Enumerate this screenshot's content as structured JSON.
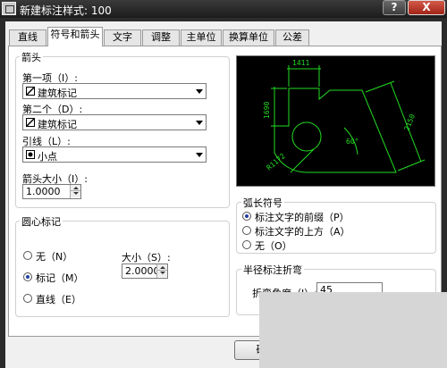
{
  "window": {
    "title": "新建标注样式: 100",
    "help_label": "?",
    "close_label": "X"
  },
  "tabs": [
    {
      "label": "直线",
      "active": false
    },
    {
      "label": "符号和箭头",
      "active": true
    },
    {
      "label": "文字",
      "active": false
    },
    {
      "label": "调整",
      "active": false
    },
    {
      "label": "主单位",
      "active": false
    },
    {
      "label": "换算单位",
      "active": false
    },
    {
      "label": "公差",
      "active": false
    }
  ],
  "arrowheads": {
    "title": "箭头",
    "first_label": "第一项（I）:",
    "first_value": "建筑标记",
    "second_label": "第二个（D）:",
    "second_value": "建筑标记",
    "leader_label": "引线（L）:",
    "leader_value": "小点",
    "size_label": "箭头大小（I）:",
    "size_value": "1.0000"
  },
  "center_marks": {
    "title": "圆心标记",
    "options": [
      {
        "label": "无（N）",
        "selected": false
      },
      {
        "label": "标记（M）",
        "selected": true
      },
      {
        "label": "直线（E）",
        "selected": false
      }
    ],
    "size_label": "大小（S）:",
    "size_value": "2.0000"
  },
  "arc_length": {
    "title": "弧长符号",
    "options": [
      {
        "label": "标注文字的前缀（P）",
        "selected": true
      },
      {
        "label": "标注文字的上方（A）",
        "selected": false
      },
      {
        "label": "无（O）",
        "selected": false
      }
    ]
  },
  "radius_jog": {
    "title": "半径标注折弯",
    "angle_label": "折弯角度（J）:",
    "angle_value": "45"
  },
  "preview": {
    "dim_top": "1411",
    "dim_left": "1690",
    "dim_right": "2150",
    "dim_angle": "60°",
    "dim_radius": "R1172",
    "color": "#22dd22"
  },
  "buttons": {
    "ok_label": "确"
  }
}
